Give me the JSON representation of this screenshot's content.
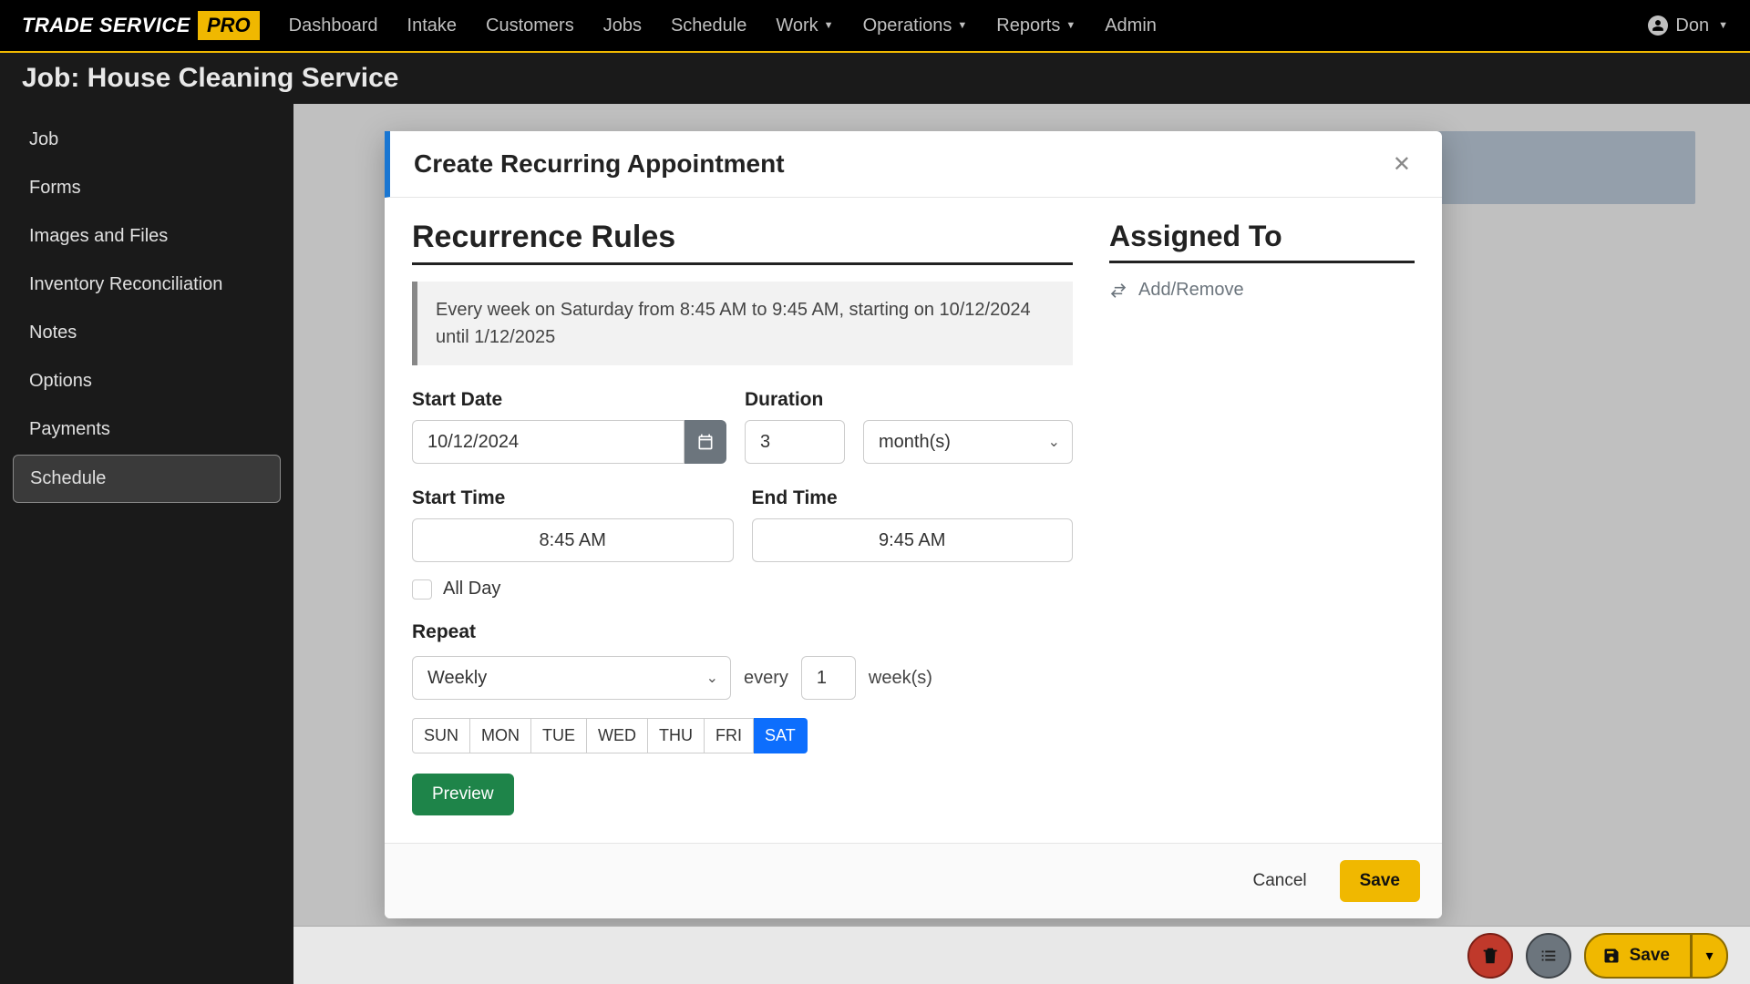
{
  "brand": {
    "text1": "TRADE SERVICE",
    "text2": "PRO"
  },
  "nav": {
    "items": [
      {
        "label": "Dashboard",
        "dropdown": false
      },
      {
        "label": "Intake",
        "dropdown": false
      },
      {
        "label": "Customers",
        "dropdown": false
      },
      {
        "label": "Jobs",
        "dropdown": false
      },
      {
        "label": "Schedule",
        "dropdown": false
      },
      {
        "label": "Work",
        "dropdown": true
      },
      {
        "label": "Operations",
        "dropdown": true
      },
      {
        "label": "Reports",
        "dropdown": true
      },
      {
        "label": "Admin",
        "dropdown": false
      }
    ]
  },
  "user": {
    "name": "Don"
  },
  "page_title": "Job: House Cleaning Service",
  "sidebar": {
    "items": [
      {
        "label": "Job"
      },
      {
        "label": "Forms"
      },
      {
        "label": "Images and Files"
      },
      {
        "label": "Inventory Reconciliation"
      },
      {
        "label": "Notes"
      },
      {
        "label": "Options"
      },
      {
        "label": "Payments"
      },
      {
        "label": "Schedule"
      }
    ],
    "active_index": 7
  },
  "modal": {
    "title": "Create Recurring Appointment",
    "recurrence_section": "Recurrence Rules",
    "summary": "Every week on Saturday from 8:45 AM to 9:45 AM, starting on 10/12/2024 until 1/12/2025",
    "labels": {
      "start_date": "Start Date",
      "duration": "Duration",
      "start_time": "Start Time",
      "end_time": "End Time",
      "all_day": "All Day",
      "repeat": "Repeat",
      "every": "every",
      "weeks": "week(s)"
    },
    "values": {
      "start_date": "10/12/2024",
      "duration_amount": "3",
      "duration_unit": "month(s)",
      "start_time": "8:45 AM",
      "end_time": "9:45 AM",
      "repeat_type": "Weekly",
      "repeat_interval": "1"
    },
    "days": [
      "SUN",
      "MON",
      "TUE",
      "WED",
      "THU",
      "FRI",
      "SAT"
    ],
    "days_active": [
      false,
      false,
      false,
      false,
      false,
      false,
      true
    ],
    "preview_btn": "Preview",
    "assigned_section": "Assigned To",
    "add_remove": "Add/Remove",
    "footer": {
      "cancel": "Cancel",
      "save": "Save"
    }
  },
  "bottom": {
    "save": "Save"
  },
  "colors": {
    "accent": "#f0b800",
    "primary_blue": "#0d6efd",
    "green": "#1e8449",
    "danger": "#c0392b"
  }
}
